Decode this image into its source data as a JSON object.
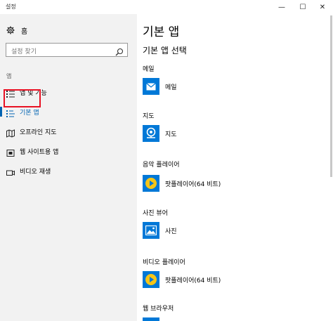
{
  "window": {
    "title": "설정",
    "minimize_glyph": "—",
    "maximize_glyph": "☐",
    "close_glyph": "✕"
  },
  "sidebar": {
    "home_label": "홈",
    "search_placeholder": "설정 찾기",
    "section_label": "앱",
    "items": [
      {
        "label": "앱 및 기능",
        "icon": "apps-list-icon",
        "selected": false
      },
      {
        "label": "기본 앱",
        "icon": "default-apps-icon",
        "selected": true
      },
      {
        "label": "오프라인 지도",
        "icon": "offline-maps-icon",
        "selected": false
      },
      {
        "label": "웹 사이트용 앱",
        "icon": "apps-for-websites-icon",
        "selected": false
      },
      {
        "label": "비디오 재생",
        "icon": "video-playback-icon",
        "selected": false
      }
    ]
  },
  "main": {
    "title": "기본 앱",
    "subtitle": "기본 앱 선택",
    "categories": [
      {
        "label": "메일",
        "app": "메일",
        "icon": "mail-icon"
      },
      {
        "label": "지도",
        "app": "지도",
        "icon": "maps-icon"
      },
      {
        "label": "음악 플레이어",
        "app": "팟플레이어(64 비트)",
        "icon": "potplayer-icon"
      },
      {
        "label": "사진 뷰어",
        "app": "사진",
        "icon": "photos-icon"
      },
      {
        "label": "비디오 플레이어",
        "app": "팟플레이어(64 비트)",
        "icon": "potplayer-icon"
      },
      {
        "label": "웹 브라우저",
        "app": "",
        "icon": ""
      }
    ]
  },
  "colors": {
    "accent": "#0063b1",
    "tile": "#0078d7",
    "highlight_box": "#e81123",
    "sidebar_bg": "#f2f2f2"
  }
}
